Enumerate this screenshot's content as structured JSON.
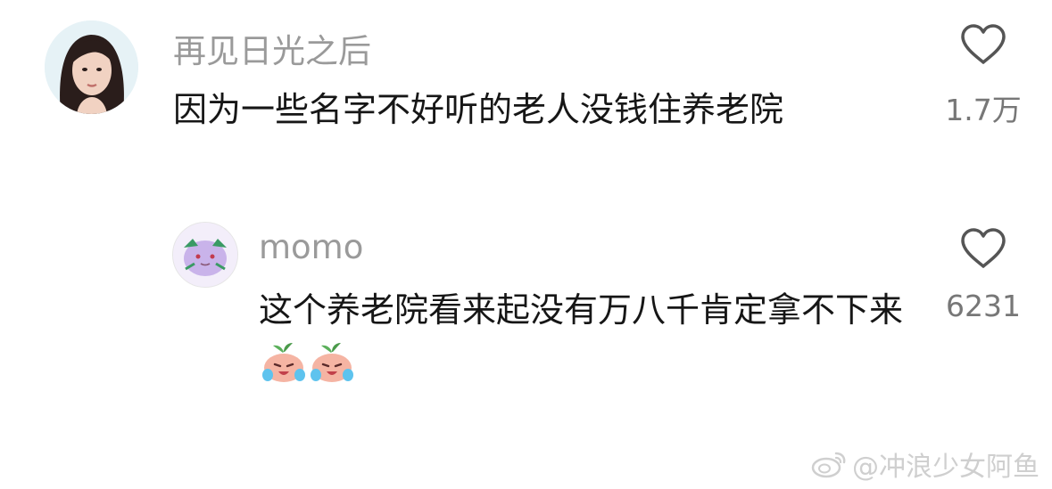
{
  "comments": [
    {
      "username": "再见日光之后",
      "text": "因为一些名字不好听的老人没钱住养老院",
      "likes": "1.7万",
      "avatar": "woman-portrait-avatar"
    },
    {
      "username": "momo",
      "text": "这个养老院看来起没有万八千肯定拿不下来",
      "likes": "6231",
      "avatar": "purple-cartoon-avatar",
      "emojis": [
        "crying-peach-emoji",
        "crying-peach-emoji"
      ]
    }
  ],
  "watermark": {
    "icon": "weibo-logo-icon",
    "text": "@冲浪少女阿鱼"
  },
  "colors": {
    "username": "#9a9a9a",
    "text": "#161616",
    "like": "#777777"
  }
}
